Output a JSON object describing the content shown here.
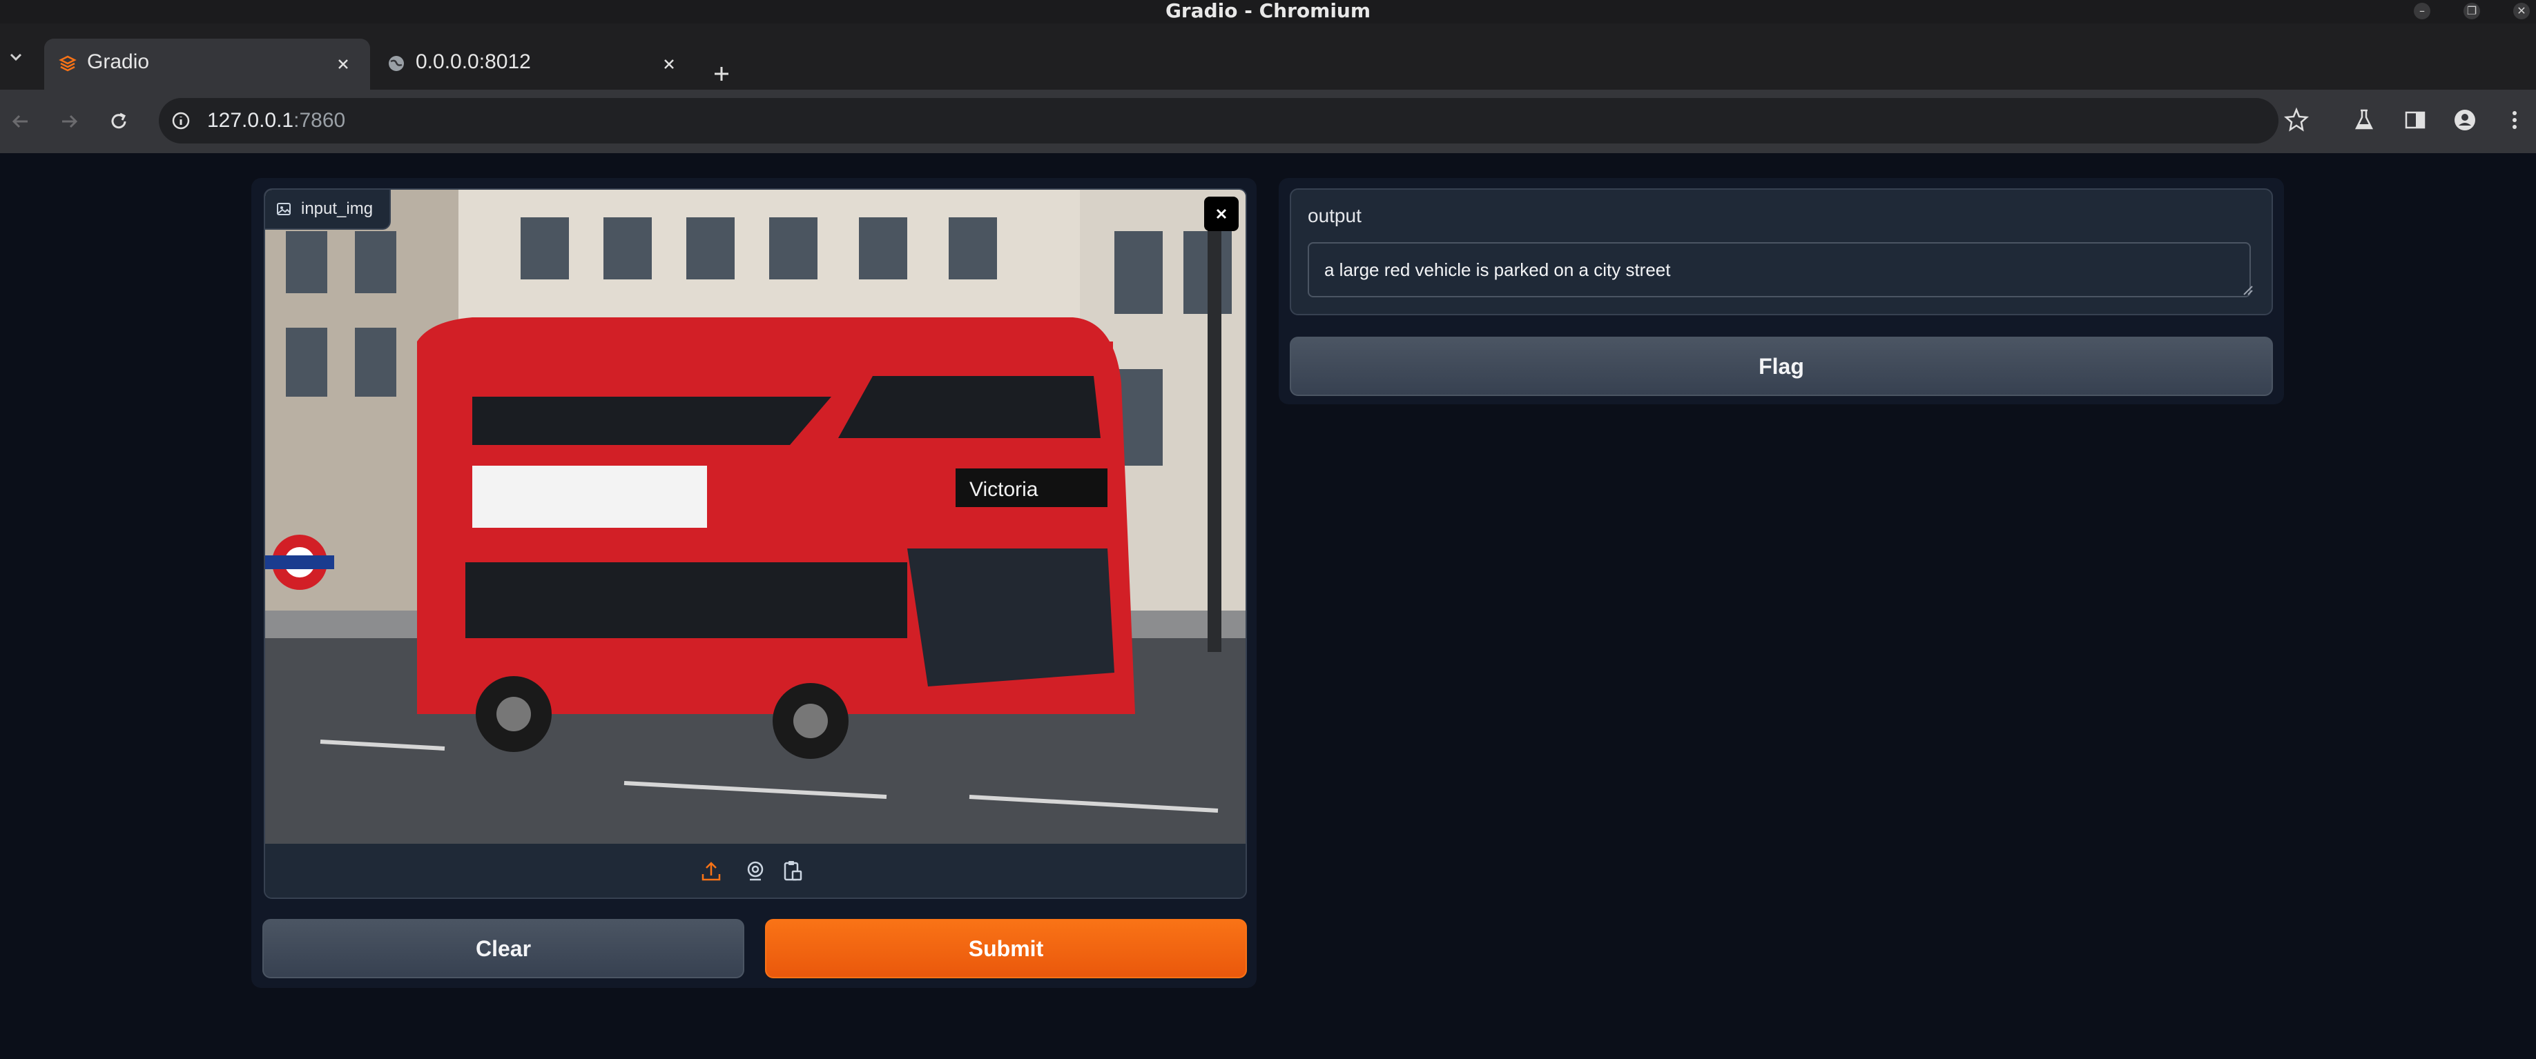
{
  "window": {
    "title": "Gradio - Chromium"
  },
  "tabs": [
    {
      "title": "Gradio",
      "favicon": "gradio-logo-icon",
      "active": true
    },
    {
      "title": "0.0.0.0:8012",
      "favicon": "globe-icon",
      "active": false
    }
  ],
  "address_bar": {
    "host": "127.0.0.1",
    "port": ":7860"
  },
  "app": {
    "input_image": {
      "label": "input_img",
      "image_alt": "red double-decker bus on a city street",
      "sources": [
        "upload-icon",
        "webcam-icon",
        "clipboard-icon"
      ]
    },
    "buttons": {
      "clear": "Clear",
      "submit": "Submit",
      "flag": "Flag"
    },
    "output": {
      "label": "output",
      "value": "a large red vehicle is parked on a city street"
    }
  },
  "colors": {
    "page_bg": "#0b0f19",
    "block_bg": "#1f2937",
    "accent": "#f97316"
  }
}
